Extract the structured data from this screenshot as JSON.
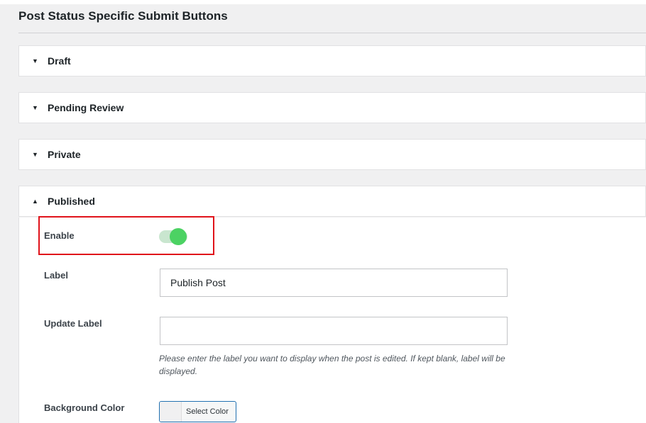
{
  "page": {
    "title": "Post Status Specific Submit Buttons"
  },
  "sections": {
    "draft": {
      "label": "Draft",
      "expanded": false
    },
    "pending": {
      "label": "Pending Review",
      "expanded": false
    },
    "private": {
      "label": "Private",
      "expanded": false
    },
    "published": {
      "label": "Published",
      "expanded": true
    }
  },
  "published_fields": {
    "enable": {
      "label": "Enable",
      "checked": true
    },
    "label": {
      "label": "Label",
      "value": "Publish Post"
    },
    "update_label": {
      "label": "Update Label",
      "value": "",
      "help": "Please enter the label you want to display when the post is edited. If kept blank, label will be displayed."
    },
    "background_color": {
      "label": "Background Color",
      "button": "Select Color"
    }
  },
  "icons": {
    "collapsed": "triangle-down-icon",
    "expanded": "triangle-up-icon",
    "arrow_down_glyph": "▼",
    "arrow_up_glyph": "▲"
  },
  "colors": {
    "toggle_on": "#4cd263",
    "highlight_annotation": "#e0131b"
  }
}
